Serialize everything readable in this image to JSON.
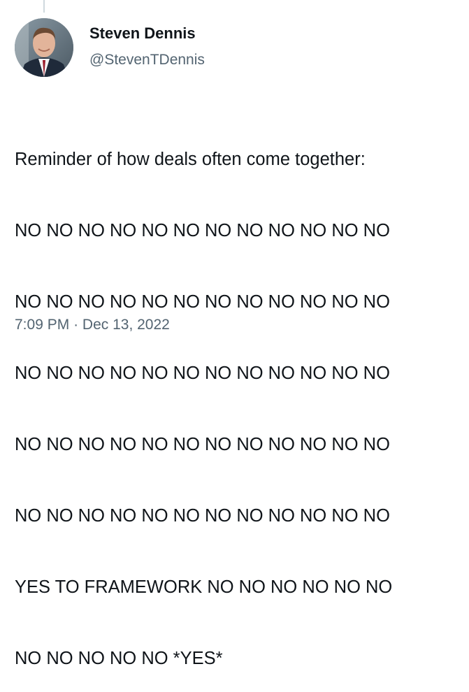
{
  "author": {
    "display_name": "Steven Dennis",
    "handle": "@StevenTDennis",
    "avatar": "profile-photo"
  },
  "tweet": {
    "lines": [
      "Reminder of how deals often come together:",
      "NO NO NO NO NO NO NO NO NO NO NO NO",
      "NO NO NO NO NO NO NO NO NO NO NO NO",
      "NO NO NO NO NO NO NO NO NO NO NO NO",
      "NO NO NO NO NO NO NO NO NO NO NO NO",
      "NO NO NO NO NO NO NO NO NO NO NO NO",
      "YES TO FRAMEWORK NO NO NO NO NO NO",
      "NO NO NO NO NO *YES*"
    ],
    "time": "7:09 PM",
    "separator": "·",
    "date": "Dec 13, 2022"
  },
  "colors": {
    "text_primary": "#0f1419",
    "text_secondary": "#536471",
    "thread_line": "#cfd9de",
    "background": "#ffffff"
  }
}
